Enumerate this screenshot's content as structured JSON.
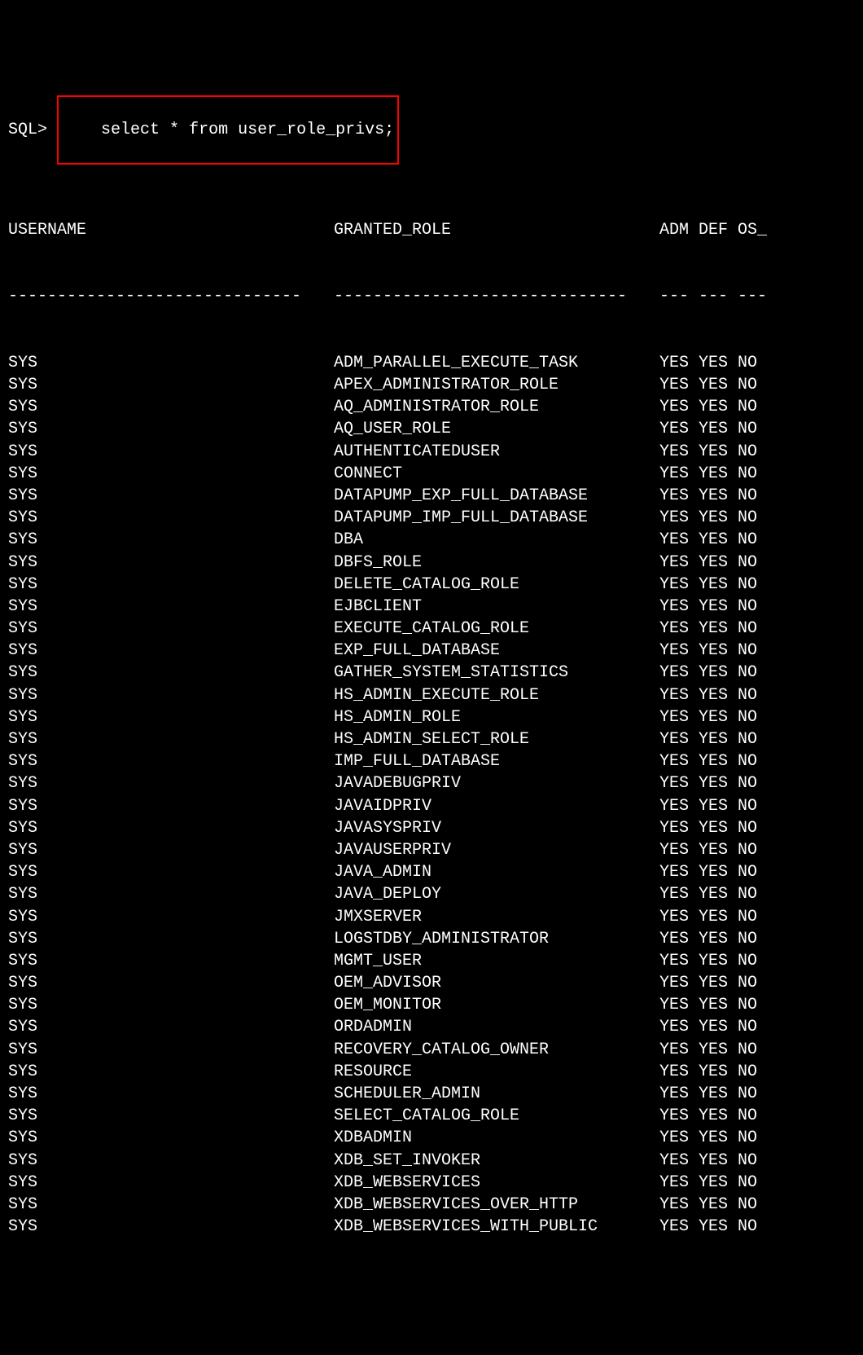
{
  "prompt": "SQL>",
  "command": "select * from user_role_privs;",
  "headers": {
    "username": "USERNAME",
    "granted_role": "GRANTED_ROLE",
    "adm": "ADM",
    "def": "DEF",
    "os": "OS_"
  },
  "dashes": {
    "username": "------------------------------",
    "granted_role": "------------------------------",
    "adm": "---",
    "def": "---",
    "os": "---"
  },
  "rows": [
    {
      "username": "SYS",
      "granted_role": "ADM_PARALLEL_EXECUTE_TASK",
      "adm": "YES",
      "def": "YES",
      "os": "NO"
    },
    {
      "username": "SYS",
      "granted_role": "APEX_ADMINISTRATOR_ROLE",
      "adm": "YES",
      "def": "YES",
      "os": "NO"
    },
    {
      "username": "SYS",
      "granted_role": "AQ_ADMINISTRATOR_ROLE",
      "adm": "YES",
      "def": "YES",
      "os": "NO"
    },
    {
      "username": "SYS",
      "granted_role": "AQ_USER_ROLE",
      "adm": "YES",
      "def": "YES",
      "os": "NO"
    },
    {
      "username": "SYS",
      "granted_role": "AUTHENTICATEDUSER",
      "adm": "YES",
      "def": "YES",
      "os": "NO"
    },
    {
      "username": "SYS",
      "granted_role": "CONNECT",
      "adm": "YES",
      "def": "YES",
      "os": "NO"
    },
    {
      "username": "SYS",
      "granted_role": "DATAPUMP_EXP_FULL_DATABASE",
      "adm": "YES",
      "def": "YES",
      "os": "NO"
    },
    {
      "username": "SYS",
      "granted_role": "DATAPUMP_IMP_FULL_DATABASE",
      "adm": "YES",
      "def": "YES",
      "os": "NO"
    },
    {
      "username": "SYS",
      "granted_role": "DBA",
      "adm": "YES",
      "def": "YES",
      "os": "NO"
    },
    {
      "username": "SYS",
      "granted_role": "DBFS_ROLE",
      "adm": "YES",
      "def": "YES",
      "os": "NO"
    },
    {
      "username": "SYS",
      "granted_role": "DELETE_CATALOG_ROLE",
      "adm": "YES",
      "def": "YES",
      "os": "NO"
    },
    {
      "username": "SYS",
      "granted_role": "EJBCLIENT",
      "adm": "YES",
      "def": "YES",
      "os": "NO"
    },
    {
      "username": "SYS",
      "granted_role": "EXECUTE_CATALOG_ROLE",
      "adm": "YES",
      "def": "YES",
      "os": "NO"
    },
    {
      "username": "SYS",
      "granted_role": "EXP_FULL_DATABASE",
      "adm": "YES",
      "def": "YES",
      "os": "NO"
    },
    {
      "username": "SYS",
      "granted_role": "GATHER_SYSTEM_STATISTICS",
      "adm": "YES",
      "def": "YES",
      "os": "NO"
    },
    {
      "username": "SYS",
      "granted_role": "HS_ADMIN_EXECUTE_ROLE",
      "adm": "YES",
      "def": "YES",
      "os": "NO"
    },
    {
      "username": "SYS",
      "granted_role": "HS_ADMIN_ROLE",
      "adm": "YES",
      "def": "YES",
      "os": "NO"
    },
    {
      "username": "SYS",
      "granted_role": "HS_ADMIN_SELECT_ROLE",
      "adm": "YES",
      "def": "YES",
      "os": "NO"
    },
    {
      "username": "SYS",
      "granted_role": "IMP_FULL_DATABASE",
      "adm": "YES",
      "def": "YES",
      "os": "NO"
    },
    {
      "username": "SYS",
      "granted_role": "JAVADEBUGPRIV",
      "adm": "YES",
      "def": "YES",
      "os": "NO"
    },
    {
      "username": "SYS",
      "granted_role": "JAVAIDPRIV",
      "adm": "YES",
      "def": "YES",
      "os": "NO"
    },
    {
      "username": "SYS",
      "granted_role": "JAVASYSPRIV",
      "adm": "YES",
      "def": "YES",
      "os": "NO"
    },
    {
      "username": "SYS",
      "granted_role": "JAVAUSERPRIV",
      "adm": "YES",
      "def": "YES",
      "os": "NO"
    },
    {
      "username": "SYS",
      "granted_role": "JAVA_ADMIN",
      "adm": "YES",
      "def": "YES",
      "os": "NO"
    },
    {
      "username": "SYS",
      "granted_role": "JAVA_DEPLOY",
      "adm": "YES",
      "def": "YES",
      "os": "NO"
    },
    {
      "username": "SYS",
      "granted_role": "JMXSERVER",
      "adm": "YES",
      "def": "YES",
      "os": "NO"
    },
    {
      "username": "SYS",
      "granted_role": "LOGSTDBY_ADMINISTRATOR",
      "adm": "YES",
      "def": "YES",
      "os": "NO"
    },
    {
      "username": "SYS",
      "granted_role": "MGMT_USER",
      "adm": "YES",
      "def": "YES",
      "os": "NO"
    },
    {
      "username": "SYS",
      "granted_role": "OEM_ADVISOR",
      "adm": "YES",
      "def": "YES",
      "os": "NO"
    },
    {
      "username": "SYS",
      "granted_role": "OEM_MONITOR",
      "adm": "YES",
      "def": "YES",
      "os": "NO"
    },
    {
      "username": "SYS",
      "granted_role": "ORDADMIN",
      "adm": "YES",
      "def": "YES",
      "os": "NO"
    },
    {
      "username": "SYS",
      "granted_role": "RECOVERY_CATALOG_OWNER",
      "adm": "YES",
      "def": "YES",
      "os": "NO"
    },
    {
      "username": "SYS",
      "granted_role": "RESOURCE",
      "adm": "YES",
      "def": "YES",
      "os": "NO"
    },
    {
      "username": "SYS",
      "granted_role": "SCHEDULER_ADMIN",
      "adm": "YES",
      "def": "YES",
      "os": "NO"
    },
    {
      "username": "SYS",
      "granted_role": "SELECT_CATALOG_ROLE",
      "adm": "YES",
      "def": "YES",
      "os": "NO"
    },
    {
      "username": "SYS",
      "granted_role": "XDBADMIN",
      "adm": "YES",
      "def": "YES",
      "os": "NO"
    },
    {
      "username": "SYS",
      "granted_role": "XDB_SET_INVOKER",
      "adm": "YES",
      "def": "YES",
      "os": "NO"
    },
    {
      "username": "SYS",
      "granted_role": "XDB_WEBSERVICES",
      "adm": "YES",
      "def": "YES",
      "os": "NO"
    },
    {
      "username": "SYS",
      "granted_role": "XDB_WEBSERVICES_OVER_HTTP",
      "adm": "YES",
      "def": "YES",
      "os": "NO"
    },
    {
      "username": "SYS",
      "granted_role": "XDB_WEBSERVICES_WITH_PUBLIC",
      "adm": "YES",
      "def": "YES",
      "os": "NO"
    }
  ]
}
